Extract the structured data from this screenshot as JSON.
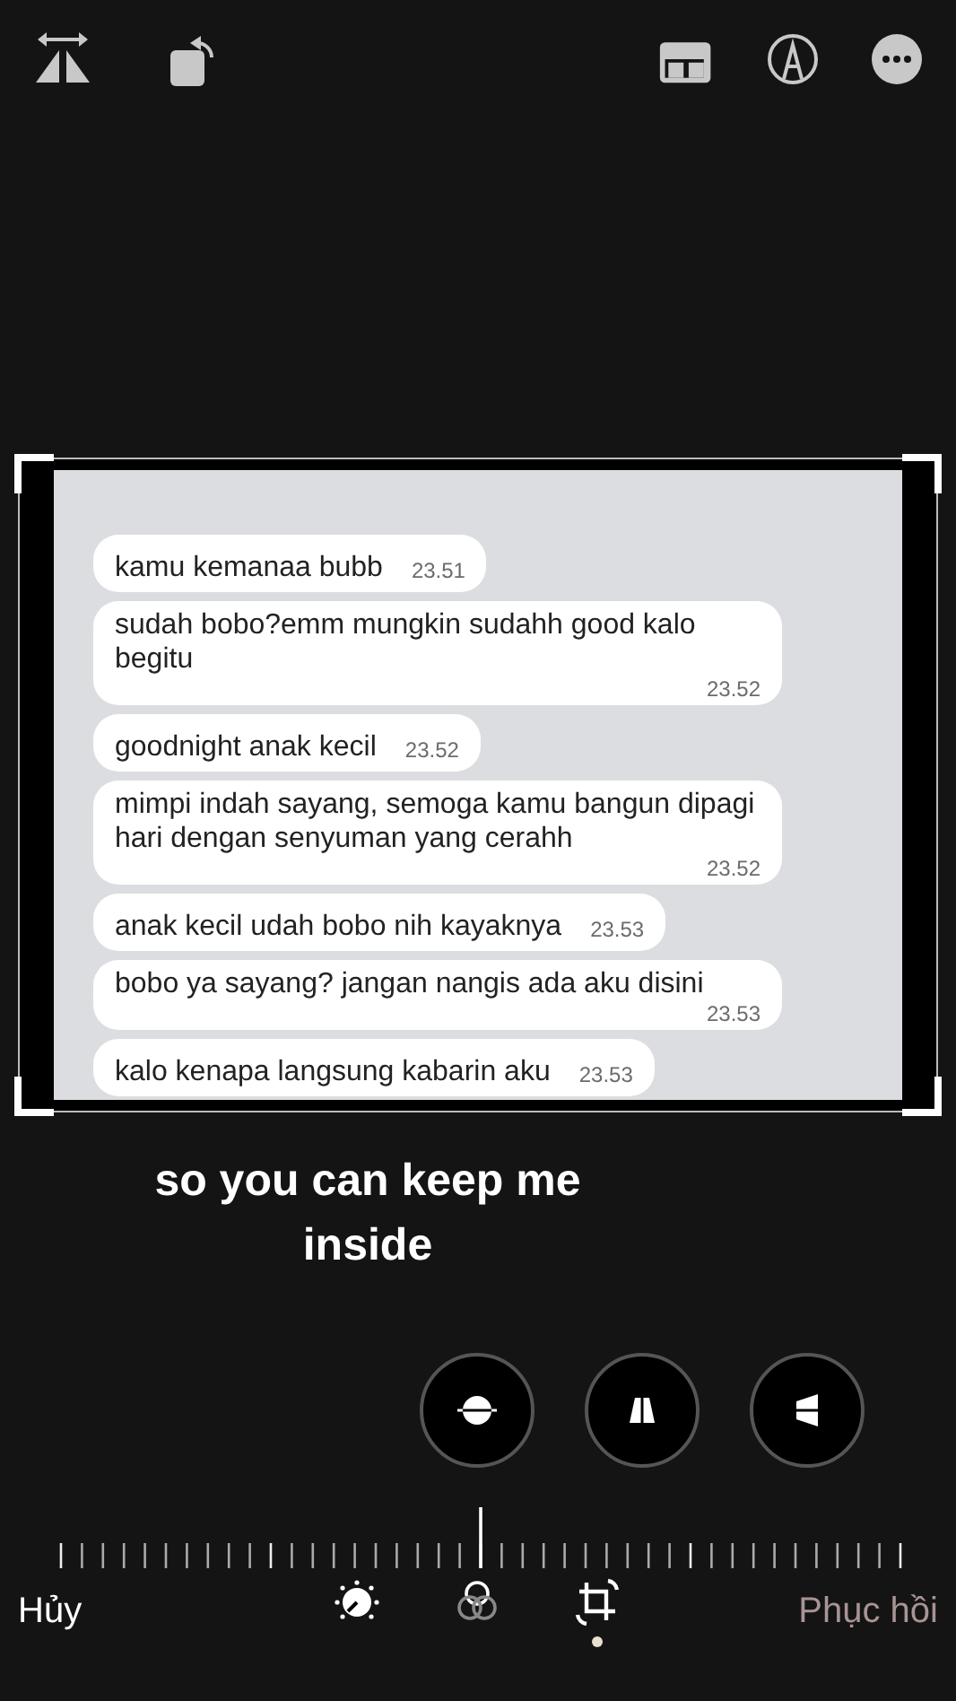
{
  "messages": [
    {
      "text": "kamu kemanaa bubb",
      "time": "23.51",
      "kind": "inline"
    },
    {
      "text": "sudah bobo?emm mungkin sudahh good kalo begitu",
      "time": "23.52",
      "kind": "block"
    },
    {
      "text": "goodnight anak kecil",
      "time": "23.52",
      "kind": "inline"
    },
    {
      "text": "mimpi indah sayang, semoga kamu bangun dipagi hari dengan senyuman yang cerahh",
      "time": "23.52",
      "kind": "block"
    },
    {
      "text": "anak kecil udah bobo nih kayaknya",
      "time": "23.53",
      "kind": "inline"
    },
    {
      "text": "bobo ya sayang? jangan nangis ada aku disini",
      "time": "23.53",
      "kind": "block"
    },
    {
      "text": "kalo kenapa langsung kabarin aku",
      "time": "23.53",
      "kind": "inline"
    }
  ],
  "caption": "so you can keep me\ninside",
  "perspective_buttons": [
    {
      "kind": "straighten"
    },
    {
      "kind": "vertical"
    },
    {
      "kind": "horizontal"
    }
  ],
  "tools": [
    {
      "kind": "adjust",
      "selected": false
    },
    {
      "kind": "filters",
      "selected": false
    },
    {
      "kind": "crop",
      "selected": true
    }
  ],
  "cancel": "Hủy",
  "revert": "Phục hồi"
}
